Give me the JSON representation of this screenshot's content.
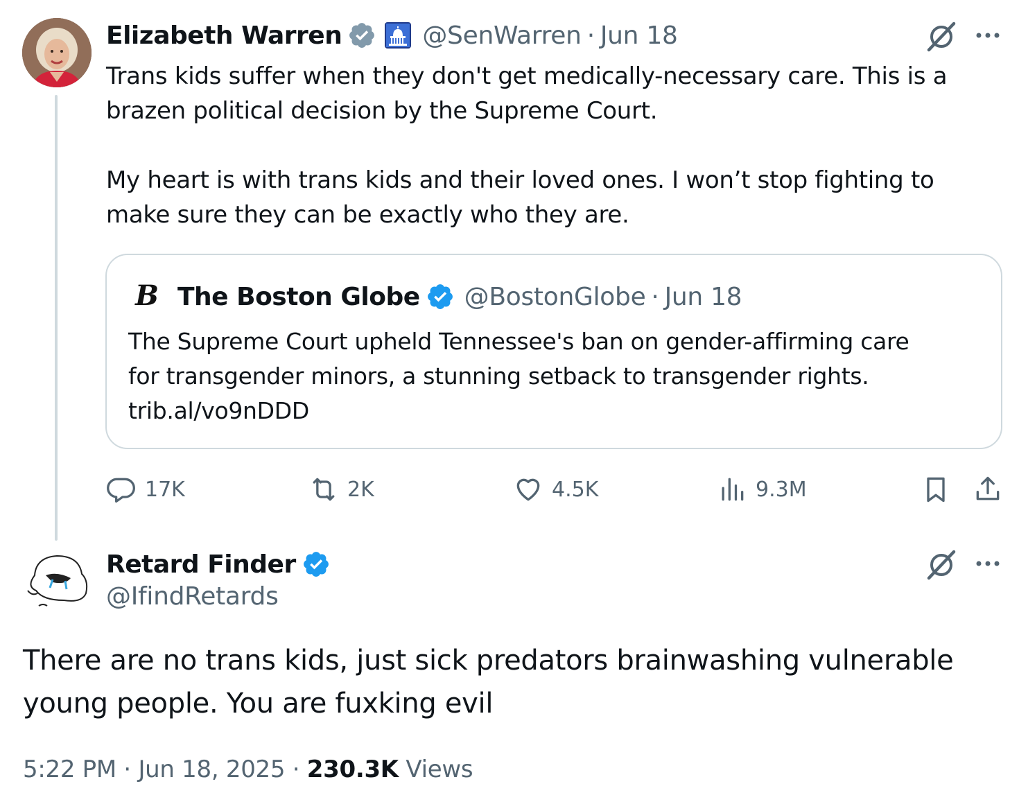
{
  "tweet": {
    "author_name": "Elizabeth Warren",
    "handle": "@SenWarren",
    "separator": "·",
    "date": "Jun 18",
    "badge_color": "#829aab",
    "text_lines": [
      "Trans kids suffer when they don't get medically-necessary care. This is a",
      "brazen political decision by the Supreme Court.",
      "My heart is with trans kids and their loved ones. I won’t stop fighting to",
      "make sure they can be exactly who they are."
    ],
    "quote": {
      "logo_text": "B",
      "author_name": "The Boston Globe",
      "handle": "@BostonGlobe",
      "date": "Jun 18",
      "badge_color": "#1d9bf0",
      "text_lines": [
        "The Supreme Court upheld Tennessee's ban on gender-affirming care",
        "for transgender minors, a stunning setback to transgender rights.",
        "trib.al/vo9nDDD"
      ]
    },
    "actions": {
      "replies": "17K",
      "reposts": "2K",
      "likes": "4.5K",
      "views": "9.3M"
    }
  },
  "reply": {
    "author_name": "Retard Finder",
    "handle": "@IfindRetards",
    "badge_color": "#1d9bf0",
    "text_lines": [
      "There are no trans kids, just sick predators brainwashing vulnerable",
      "young people. You are fuxking evil"
    ],
    "time": "5:22 PM",
    "date": "Jun 18, 2025",
    "views_count": "230.3K",
    "views_label": "Views"
  },
  "icons": [
    "verified-badge-icon",
    "capitol-icon",
    "grok-icon",
    "more-icon",
    "reply-icon",
    "repost-icon",
    "like-icon",
    "views-icon",
    "bookmark-icon",
    "share-icon"
  ]
}
